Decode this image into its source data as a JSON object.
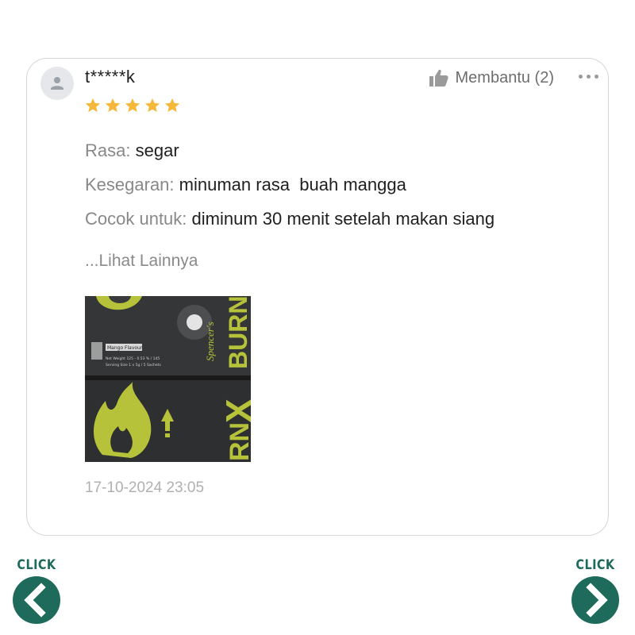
{
  "review": {
    "username": "t*****k",
    "rating": 5,
    "star_color": "#f5b83b",
    "helpful_label": "Membantu (2)",
    "attributes": [
      {
        "key": "Rasa:",
        "value": "segar"
      },
      {
        "key": "Kesegaran:",
        "value": "minuman rasa  buah mangga"
      },
      {
        "key": "Cocok untuk:",
        "value": "diminum 30 menit setelah makan siang"
      }
    ],
    "see_more": "...Lihat Lainnya",
    "photo": {
      "brand_script": "Spencer's",
      "brand_word": "BURN",
      "brand_x": "X",
      "flavor": "Mango Flavour",
      "net_weight": "Net Weight 125 - 0.53 % / 145",
      "serving": "Serving Size 1 x 5g / 5 Sachets"
    },
    "timestamp": "17-10-2024 23:05"
  },
  "nav": {
    "prev_label": "CLICK",
    "next_label": "CLICK",
    "color": "#1e6b5c"
  },
  "icons": {
    "avatar": "user-icon",
    "helpful": "thumbs-up-icon",
    "more": "more-options-icon",
    "prev": "chevron-left-icon",
    "next": "chevron-right-icon"
  }
}
